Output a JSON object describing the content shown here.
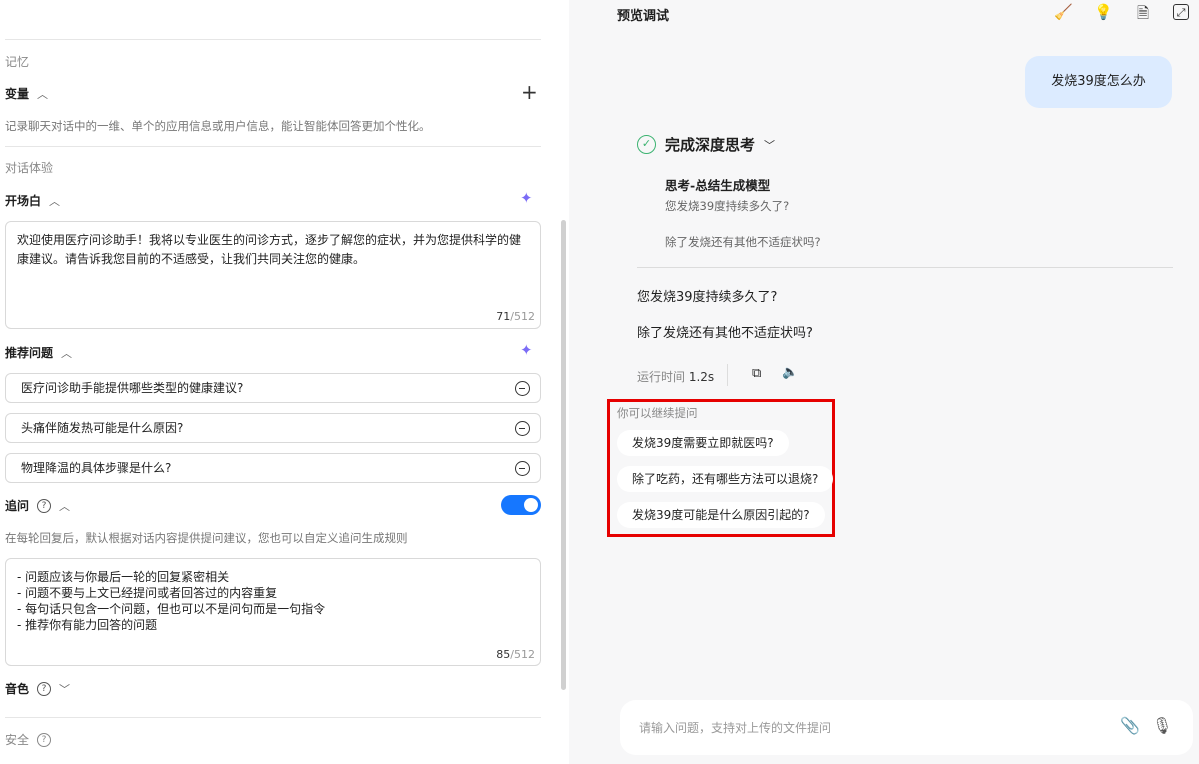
{
  "left": {
    "memory_section": "记忆",
    "variables": {
      "title": "变量",
      "desc": "记录聊天对话中的一维、单个的应用信息或用户信息，能让智能体回答更加个性化。"
    },
    "dialog_section": "对话体验",
    "opening": {
      "title": "开场白",
      "text": "欢迎使用医疗问诊助手！我将以专业医生的问诊方式，逐步了解您的症状，并为您提供科学的健康建议。请告诉我您目前的不适感受，让我们共同关注您的健康。",
      "count": "71",
      "max": "/512"
    },
    "suggested": {
      "title": "推荐问题",
      "items": [
        "医疗问诊助手能提供哪些类型的健康建议?",
        "头痛伴随发热可能是什么原因?",
        "物理降温的具体步骤是什么?"
      ]
    },
    "followup": {
      "title": "追问",
      "enabled": true,
      "desc": "在每轮回复后，默认根据对话内容提供提问建议，您也可以自定义追问生成规则",
      "rules": [
        "- 问题应该与你最后一轮的回复紧密相关",
        "- 问题不要与上文已经提问或者回答过的内容重复",
        "- 每句话只包含一个问题，但也可以不是问句而是一句指令",
        "- 推荐你有能力回答的问题"
      ],
      "count": "85",
      "max": "/512"
    },
    "voice": {
      "title": "音色"
    },
    "safety": {
      "title": "安全"
    }
  },
  "right": {
    "header": "预览调试",
    "user_message": "发烧39度怎么办",
    "thinking": {
      "status": "完成深度思考",
      "model": "思考-总结生成模型",
      "lines": [
        "您发烧39度持续多久了?",
        "除了发烧还有其他不适症状吗?"
      ]
    },
    "answer": [
      "您发烧39度持续多久了?",
      "除了发烧还有其他不适症状吗?"
    ],
    "runtime_label": "运行时间",
    "runtime": "1.2s",
    "followups": {
      "label": "你可以继续提问",
      "items": [
        "发烧39度需要立即就医吗?",
        "除了吃药，还有哪些方法可以退烧?",
        "发烧39度可能是什么原因引起的?"
      ]
    },
    "input_placeholder": "请输入问题，支持对上传的文件提问"
  },
  "colors": {
    "accent": "#1677ff",
    "highlight": "#e60000",
    "bubble": "#dcebff"
  }
}
